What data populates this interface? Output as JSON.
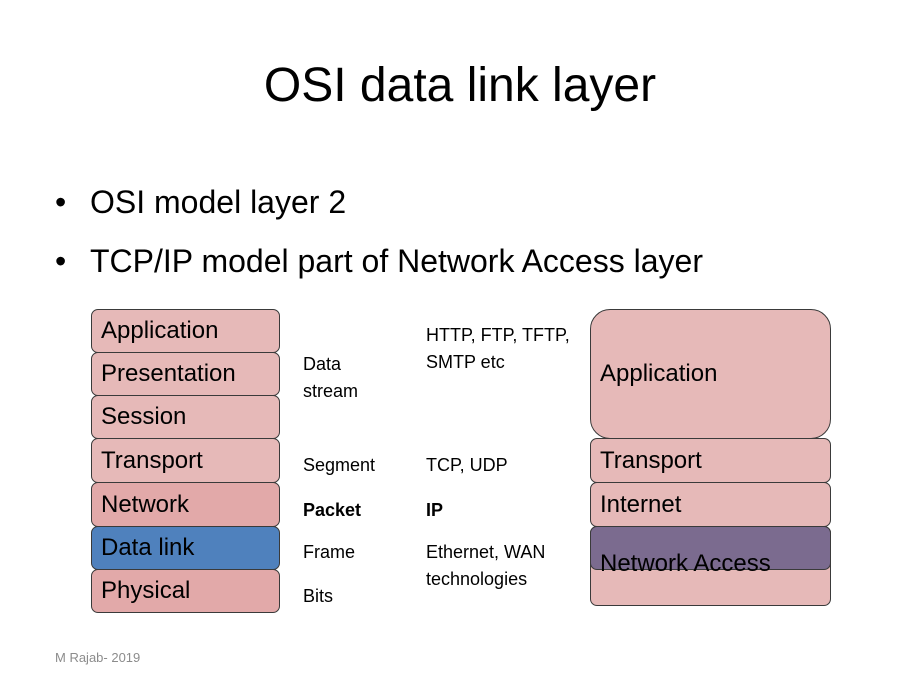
{
  "title": "OSI data link layer",
  "bullets": [
    "OSI model layer 2",
    "TCP/IP model part of Network Access layer"
  ],
  "osi_layers": [
    "Application",
    "Presentation",
    "Session",
    "Transport",
    "Network",
    "Data link",
    "Physical"
  ],
  "pdu_labels": {
    "data_stream": "Data stream",
    "segment": "Segment",
    "packet": "Packet",
    "frame": "Frame",
    "bits": "Bits"
  },
  "protocols": {
    "application": "HTTP, FTP, TFTP, SMTP etc",
    "transport": "TCP, UDP",
    "network": "IP",
    "data_link": "Ethernet, WAN technologies"
  },
  "tcpip_layers": [
    "Application",
    "Transport",
    "Internet",
    "Network Access"
  ],
  "colors": {
    "osi_upper": "#e6b9b8",
    "osi_lower": "#e2a9a9",
    "highlight_data_link": "#4f81bd",
    "highlight_network_access": "#7b6b8f"
  },
  "footer": "M Rajab- 2019"
}
